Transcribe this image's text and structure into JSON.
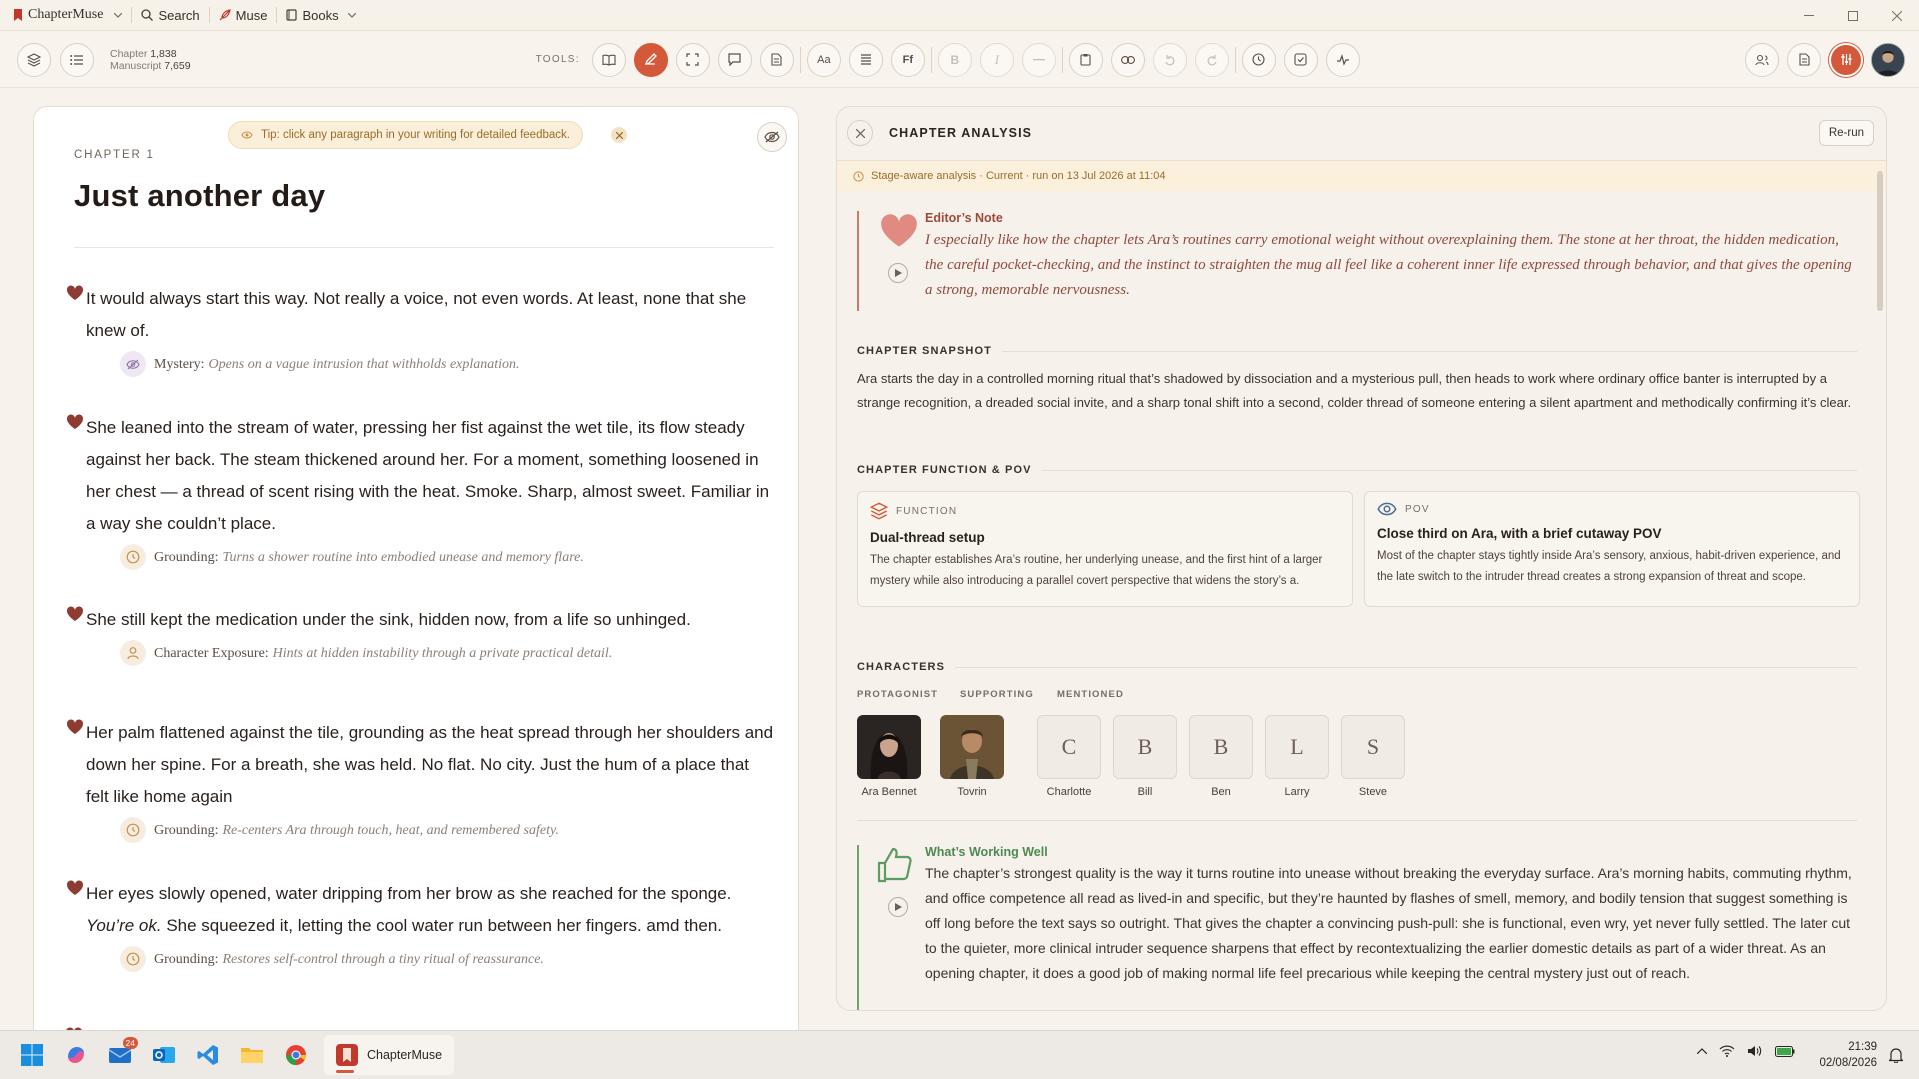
{
  "titlebar": {
    "app_name": "ChapterMuse",
    "search": "Search",
    "muse": "Muse",
    "books": "Books"
  },
  "toolbar": {
    "chapter_label": "Chapter",
    "chapter_count": "1,838",
    "manuscript_label": "Manuscript",
    "manuscript_count": "7,659",
    "tools_label": "TOOLS:",
    "font_btn": "Aa",
    "ff_btn": "Ff",
    "bold_btn": "B",
    "italic_btn": "I"
  },
  "editor": {
    "tip": "Tip: click any paragraph in your writing for detailed feedback.",
    "chapter_label": "CHAPTER 1",
    "chapter_title": "Just another day",
    "paragraphs": [
      {
        "text": "It would always start this way. Not really a voice, not even words. At least, none that she knew of.",
        "fb_type": "Mystery:",
        "fb_desc": "Opens on a vague intrusion that withholds explanation."
      },
      {
        "text": "She leaned into the stream of water, pressing her fist against the wet tile, its flow steady against her back. The steam thickened around her. For a moment, something loosened in her chest — a thread of scent rising with the heat. Smoke. Sharp, almost sweet. Familiar in a way she couldn’t place.",
        "fb_type": "Grounding:",
        "fb_desc": "Turns a shower routine into embodied unease and memory flare."
      },
      {
        "text": "She still kept the medication under the sink, hidden now, from a life so unhinged.",
        "fb_type": "Character Exposure:",
        "fb_desc": "Hints at hidden instability through a private practical detail."
      },
      {
        "text": "Her palm flattened against the tile, grounding as the heat spread through her shoulders and down her spine. For a breath, she was held. No flat. No city. Just the hum of a place that felt like home again",
        "fb_type": "Grounding:",
        "fb_desc": "Re-centers Ara through touch, heat, and remembered safety."
      },
      {
        "text_before": "Her eyes slowly opened, water dripping from her brow as she reached for the sponge. ",
        "text_italic": "You’re ok.",
        "text_after": " She squeezed it, letting the cool water run between her fingers. amd then.",
        "fb_type": "Grounding:",
        "fb_desc": "Restores self-control through a tiny ritual of reassurance."
      }
    ]
  },
  "analysis": {
    "title": "CHAPTER ANALYSIS",
    "rerun": "Re-run",
    "stage": "Stage-aware analysis · Current · run on 13 Jul 2026 at 11:04",
    "editor_note_title": "Editor’s Note",
    "editor_note": "I especially like how the chapter lets Ara’s routines carry emotional weight without overexplaining them. The stone at her throat, the hidden medication, the careful pocket-checking, and the instinct to straighten the mug all feel like a coherent inner life expressed through behavior, and that gives the opening a strong, memorable nervousness.",
    "snapshot_title": "CHAPTER SNAPSHOT",
    "snapshot": "Ara starts the day in a controlled morning ritual that’s shadowed by dissociation and a mysterious pull, then heads to work where ordinary office banter is interrupted by a strange recognition, a dreaded social invite, and a sharp tonal shift into a second, colder thread of someone entering a silent apartment and methodically confirming it’s clear.",
    "function_pov_title": "CHAPTER FUNCTION & POV",
    "function_label": "FUNCTION",
    "function_title": "Dual-thread setup",
    "function_text": "The chapter establishes Ara’s routine, her underlying unease, and the first hint of a larger mystery while also introducing a parallel covert perspective that widens the story’s a.",
    "pov_label": "POV",
    "pov_title": "Close third on Ara, with a brief cutaway POV",
    "pov_text": "Most of the chapter stays tightly inside Ara’s sensory, anxious, habit-driven experience, and the late switch to the intruder thread creates a strong expansion of threat and scope.",
    "characters_title": "CHARACTERS",
    "protagonist_label": "PROTAGONIST",
    "supporting_label": "SUPPORTING",
    "mentioned_label": "MENTIONED",
    "protagonist": "Ara Bennet",
    "supporting": "Tovrin",
    "mentioned": [
      {
        "initial": "C",
        "name": "Charlotte"
      },
      {
        "initial": "B",
        "name": "Bill"
      },
      {
        "initial": "B",
        "name": "Ben"
      },
      {
        "initial": "L",
        "name": "Larry"
      },
      {
        "initial": "S",
        "name": "Steve"
      }
    ],
    "working_title": "What’s Working Well",
    "working_text": "The chapter’s strongest quality is the way it turns routine into unease without breaking the everyday surface. Ara’s morning habits, commuting rhythm, and office competence all read as lived-in and specific, but they’re haunted by flashes of smell, memory, and bodily tension that suggest something is off long before the text says so outright. That gives the chapter a convincing push-pull: she is functional, even wry, yet never fully settled. The later cut to the quieter, more clinical intruder sequence sharpens that effect by recontextualizing the earlier domestic details as part of a wider threat. As an opening chapter, it does a good job of making normal life feel precarious while keeping the central mystery just out of reach."
  },
  "taskbar": {
    "app_label": "ChapterMuse",
    "mail_badge": "24",
    "time": "21:39",
    "date": "02/08/2026"
  },
  "colors": {
    "accent": "#d4583a",
    "heart": "#8e3b33",
    "editor_note": "#9e4a3b",
    "working": "#4d8a52"
  }
}
